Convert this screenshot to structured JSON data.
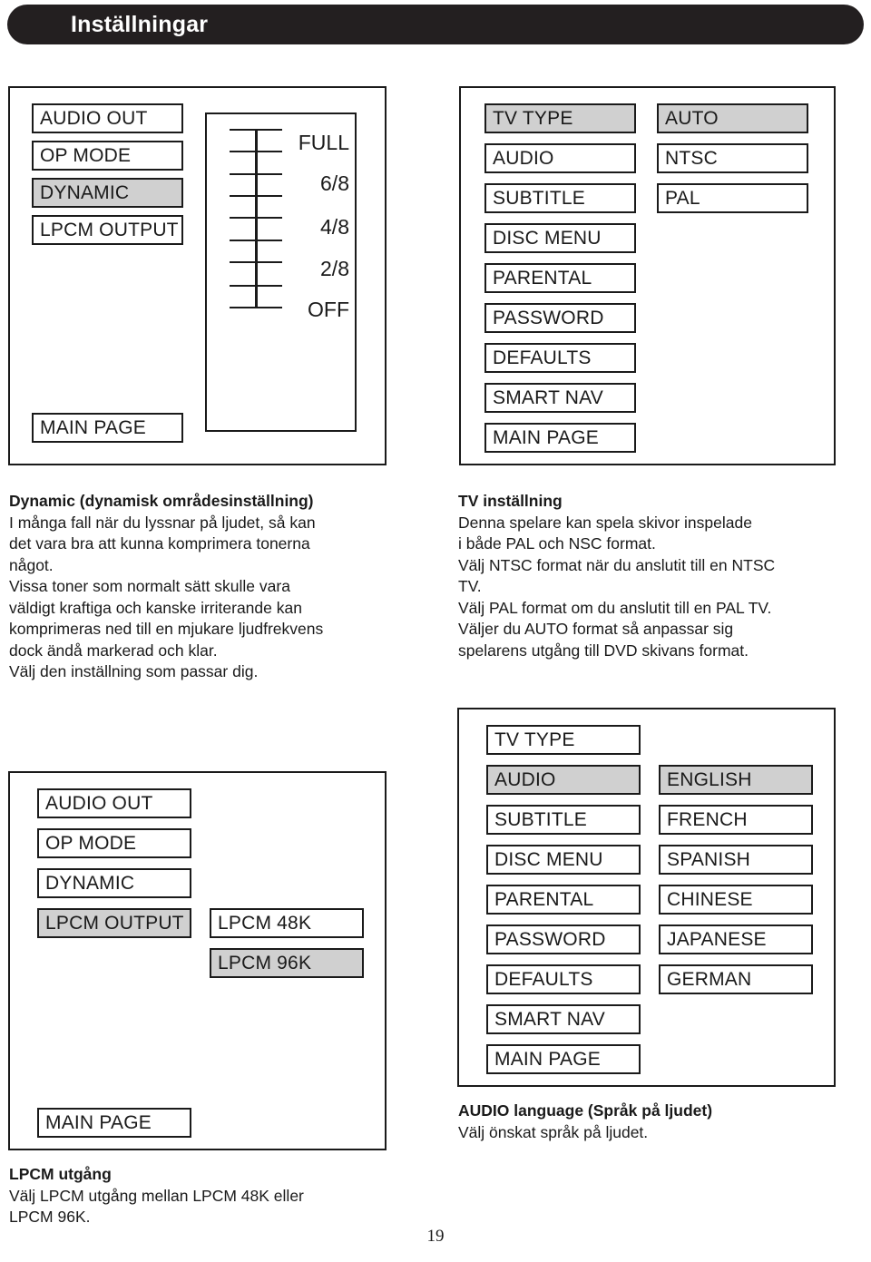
{
  "header": {
    "title": "Inställningar"
  },
  "panels": {
    "audio_dynamic": {
      "name": "audio-setup-dynamic",
      "menu": [
        {
          "label": "AUDIO OUT",
          "selected": false
        },
        {
          "label": "OP MODE",
          "selected": false
        },
        {
          "label": "DYNAMIC",
          "selected": true
        },
        {
          "label": "LPCM OUTPUT",
          "selected": false
        }
      ],
      "main_page": "MAIN PAGE",
      "scale": {
        "labels": [
          "FULL",
          "6/8",
          "4/8",
          "2/8",
          "OFF"
        ],
        "tick_count": 9
      }
    },
    "tv_type": {
      "name": "preferences-tv-type",
      "menu": [
        {
          "label": "TV TYPE",
          "selected": true
        },
        {
          "label": "AUDIO",
          "selected": false
        },
        {
          "label": "SUBTITLE",
          "selected": false
        },
        {
          "label": "DISC MENU",
          "selected": false
        },
        {
          "label": "PARENTAL",
          "selected": false
        },
        {
          "label": "PASSWORD",
          "selected": false
        },
        {
          "label": "DEFAULTS",
          "selected": false
        },
        {
          "label": "SMART NAV",
          "selected": false
        },
        {
          "label": "MAIN PAGE",
          "selected": false
        }
      ],
      "options": [
        {
          "label": "AUTO",
          "selected": true
        },
        {
          "label": "NTSC",
          "selected": false
        },
        {
          "label": "PAL",
          "selected": false
        }
      ]
    },
    "lpcm_output": {
      "name": "audio-setup-lpcm",
      "menu": [
        {
          "label": "AUDIO OUT",
          "selected": false
        },
        {
          "label": "OP MODE",
          "selected": false
        },
        {
          "label": "DYNAMIC",
          "selected": false
        },
        {
          "label": "LPCM OUTPUT",
          "selected": true
        }
      ],
      "main_page": "MAIN PAGE",
      "options": [
        {
          "label": "LPCM 48K",
          "selected": false
        },
        {
          "label": "LPCM 96K",
          "selected": true
        }
      ]
    },
    "audio_language": {
      "name": "preferences-audio-language",
      "menu": [
        {
          "label": "TV TYPE",
          "selected": false
        },
        {
          "label": "AUDIO",
          "selected": true
        },
        {
          "label": "SUBTITLE",
          "selected": false
        },
        {
          "label": "DISC MENU",
          "selected": false
        },
        {
          "label": "PARENTAL",
          "selected": false
        },
        {
          "label": "PASSWORD",
          "selected": false
        },
        {
          "label": "DEFAULTS",
          "selected": false
        },
        {
          "label": "SMART NAV",
          "selected": false
        },
        {
          "label": "MAIN PAGE",
          "selected": false
        }
      ],
      "options": [
        {
          "label": "ENGLISH",
          "selected": true
        },
        {
          "label": "FRENCH",
          "selected": false
        },
        {
          "label": "SPANISH",
          "selected": false
        },
        {
          "label": "CHINESE",
          "selected": false
        },
        {
          "label": "JAPANESE",
          "selected": false
        },
        {
          "label": "GERMAN",
          "selected": false
        }
      ]
    }
  },
  "texts": {
    "dynamic": {
      "title": "Dynamic (dynamisk områdesinställning)",
      "lines": [
        "I många fall när du lyssnar på ljudet, så kan",
        "det vara bra att kunna komprimera tonerna",
        "något.",
        "Vissa toner som normalt sätt skulle vara",
        "väldigt kraftiga och kanske irriterande kan",
        "komprimeras ned till en mjukare ljudfrekvens",
        "dock ändå markerad och klar.",
        "Välj den inställning som passar dig."
      ]
    },
    "tv": {
      "title": "TV inställning",
      "lines": [
        "Denna spelare kan spela skivor inspelade",
        "i både PAL och NSC format.",
        "Välj NTSC format när du anslutit till en NTSC",
        "TV.",
        "Välj PAL format om du anslutit till en PAL TV.",
        "Väljer du AUTO format så anpassar sig",
        "spelarens utgång till DVD skivans format."
      ]
    },
    "audio_language": {
      "title": "AUDIO language (Språk på ljudet)",
      "lines": [
        "Välj önskat språk på ljudet."
      ]
    },
    "lpcm": {
      "title": "LPCM utgång",
      "lines": [
        "Välj LPCM utgång mellan LPCM 48K eller",
        "LPCM 96K."
      ]
    }
  },
  "footer": {
    "page_number": "19"
  },
  "colors": {
    "header_bg": "#231f20",
    "header_text": "#ffffff",
    "selection_bg": "#d0d0d0",
    "outline": "#1a1a1a"
  }
}
